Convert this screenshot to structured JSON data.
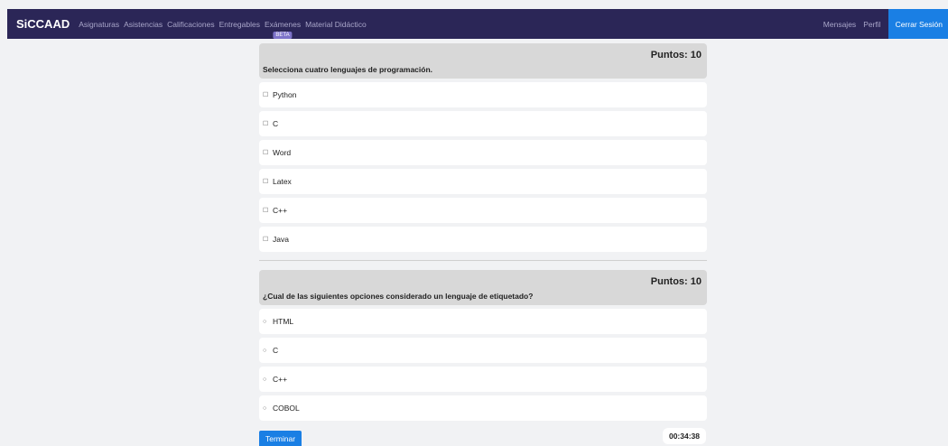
{
  "nav": {
    "brand": "SiCCAAD",
    "links": [
      "Asignaturas",
      "Asistencias",
      "Calificaciones",
      "Entregables",
      "Exámenes",
      "Material Didáctico"
    ],
    "beta": "BETA",
    "right_links": [
      "Mensajes",
      "Perfil"
    ],
    "logout": "Cerrar Sesión"
  },
  "questions": [
    {
      "points": "Puntos: 10",
      "text": "Selecciona cuatro lenguajes de programación.",
      "type": "checkbox",
      "options": [
        "Python",
        "C",
        "Word",
        "Latex",
        "C++",
        "Java"
      ]
    },
    {
      "points": "Puntos: 10",
      "text": "¿Cual de las siguientes opciones considerado un lenguaje de etiquetado?",
      "type": "radio",
      "options": [
        "HTML",
        "C",
        "C++",
        "COBOL"
      ]
    }
  ],
  "footer": {
    "finish_label": "Terminar",
    "timer": "00:34:38"
  },
  "colors": {
    "navbar": "#2b2657",
    "accent": "#1a7fe4",
    "beta": "#7d73c9"
  }
}
